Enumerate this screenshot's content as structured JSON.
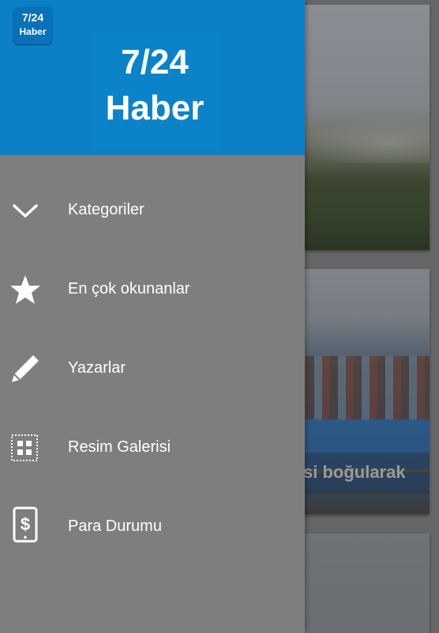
{
  "app": {
    "icon_line1": "7/24",
    "icon_line2": "Haber",
    "logo_line1": "7/24",
    "logo_line2": "Haber"
  },
  "menu": {
    "items": [
      {
        "label": "Kategoriler",
        "icon": "chevron-down-icon"
      },
      {
        "label": "En çok okunanlar",
        "icon": "star-icon"
      },
      {
        "label": "Yazarlar",
        "icon": "pencil-icon"
      },
      {
        "label": "Resim Galerisi",
        "icon": "gallery-grid-icon"
      },
      {
        "label": "Para Durumu",
        "icon": "phone-dollar-icon"
      }
    ]
  },
  "news": {
    "items": [
      {
        "title": ""
      },
      {
        "title": "si boğularak"
      },
      {
        "title": ""
      }
    ]
  },
  "colors": {
    "header_blue": "#0b80c8",
    "drawer_gray": "#7e7e7e",
    "text_white": "#ffffff"
  }
}
